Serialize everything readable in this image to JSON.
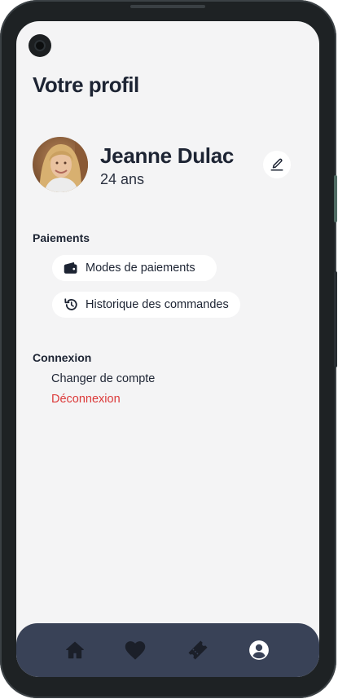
{
  "page": {
    "title": "Votre profil"
  },
  "profile": {
    "name": "Jeanne Dulac",
    "age": "24 ans"
  },
  "payments": {
    "title": "Paiements",
    "items": [
      {
        "label": "Modes de paiements",
        "icon": "wallet-icon"
      },
      {
        "label": "Historique des commandes",
        "icon": "history-icon"
      }
    ]
  },
  "connection": {
    "title": "Connexion",
    "switch_account": "Changer de compte",
    "logout": "Déconnexion"
  },
  "nav": {
    "items": [
      {
        "icon": "home-icon",
        "active": false
      },
      {
        "icon": "heart-icon",
        "active": false
      },
      {
        "icon": "ticket-icon",
        "active": false
      },
      {
        "icon": "account-circle-icon",
        "active": true
      }
    ]
  },
  "colors": {
    "text": "#1d2433",
    "danger": "#dc3a3a",
    "nav_background": "#394257",
    "nav_icon": "#1b1f29",
    "nav_icon_active": "#ffffff"
  }
}
